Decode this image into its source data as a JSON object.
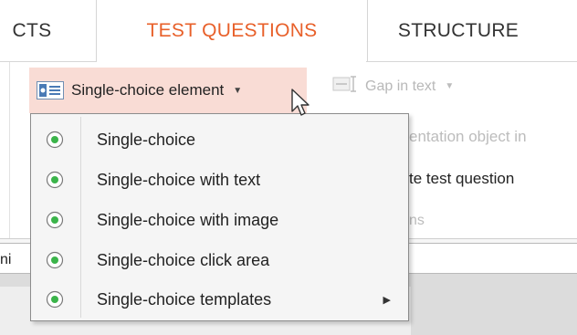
{
  "tabs": [
    {
      "label": "CTS",
      "active": false
    },
    {
      "label": "TEST QUESTIONS",
      "active": true
    },
    {
      "label": "STRUCTURE",
      "active": false
    }
  ],
  "toolbar": {
    "single_choice_label": "Single-choice element",
    "single_choice_icon": "listbox-icon",
    "gap_label": "Gap in text",
    "gap_icon": "gap-text-icon"
  },
  "background_text": {
    "line1": "entation object in",
    "line2": "te test question",
    "line3": "ns"
  },
  "document_tab": {
    "label": "ni"
  },
  "menu": {
    "items": [
      {
        "label": "Single-choice",
        "icon": "radio-icon",
        "has_submenu": false
      },
      {
        "label": "Single-choice with text",
        "icon": "radio-icon",
        "has_submenu": false
      },
      {
        "label": "Single-choice with image",
        "icon": "radio-icon",
        "has_submenu": false
      },
      {
        "label": "Single-choice click area",
        "icon": "radio-icon",
        "has_submenu": false
      },
      {
        "label": "Single-choice templates",
        "icon": "radio-icon",
        "has_submenu": true
      }
    ]
  },
  "colors": {
    "accent": "#e8602a",
    "button_highlight": "#f9dcd5",
    "radio_green": "#3bb44a"
  }
}
